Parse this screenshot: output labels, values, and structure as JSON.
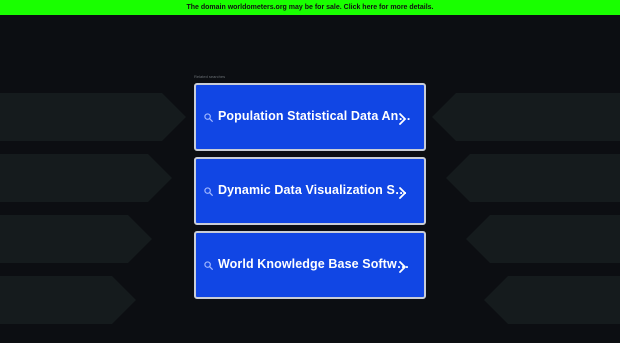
{
  "banner": {
    "text": "The domain worldometers.org may be for sale. Click here for more details."
  },
  "recent_searches": {
    "label": "Related searches",
    "items": [
      {
        "label": "Population Statistical Data An…"
      },
      {
        "label": "Dynamic Data Visualization S…"
      },
      {
        "label": "World Knowledge Base Softw…"
      }
    ]
  },
  "colors": {
    "banner_bg": "#19ff00",
    "button_bg": "#1146e4",
    "button_border": "#c9cdd6",
    "page_bg": "#0c0e12"
  },
  "icons": {
    "search": "magnifier-icon",
    "chevron": "chevron-right-icon"
  }
}
